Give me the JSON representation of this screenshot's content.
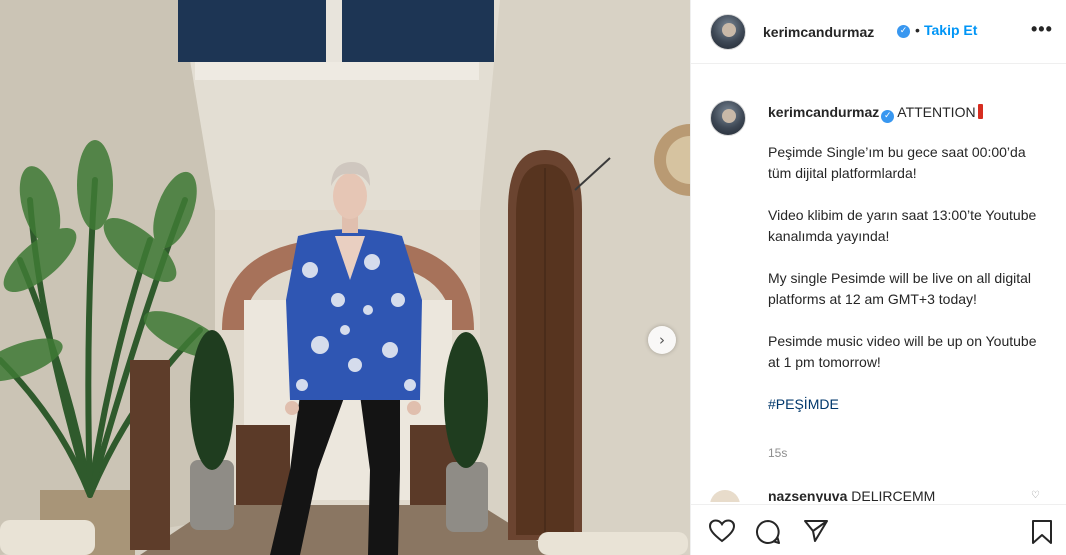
{
  "post": {
    "username": "kerimcandurmaz",
    "verified_icon": "verified-badge-icon",
    "separator": "•",
    "follow_label": "Takip Et",
    "more_label": "•••",
    "caption": {
      "username": "kerimcandurmaz",
      "title": "ATTENTION",
      "paragraphs": [
        "Peşimde Single’ım bu gece saat 00:00’da tüm dijital platformlarda!",
        "Video klibim de yarın saat 13:00’te Youtube kanalımda yayında!",
        "My single Pesimde will be live on all digital platforms at 12 am GMT+3 today!",
        "Pesimde music video will be up on Youtube at 1 pm tomorrow!"
      ],
      "hashtag": "#PEŞİMDE",
      "time": "15s"
    },
    "comment_peek": {
      "username": "nazsenyuva",
      "text": "DELIRCEMM"
    },
    "actions": [
      "heart-icon",
      "comment-icon",
      "share-icon",
      "bookmark-icon"
    ],
    "next_label": "›"
  },
  "colors": {
    "accent": "#0095f6",
    "verified": "#3897f0",
    "hashtag": "#00376b",
    "muted": "#8e8e8e"
  }
}
